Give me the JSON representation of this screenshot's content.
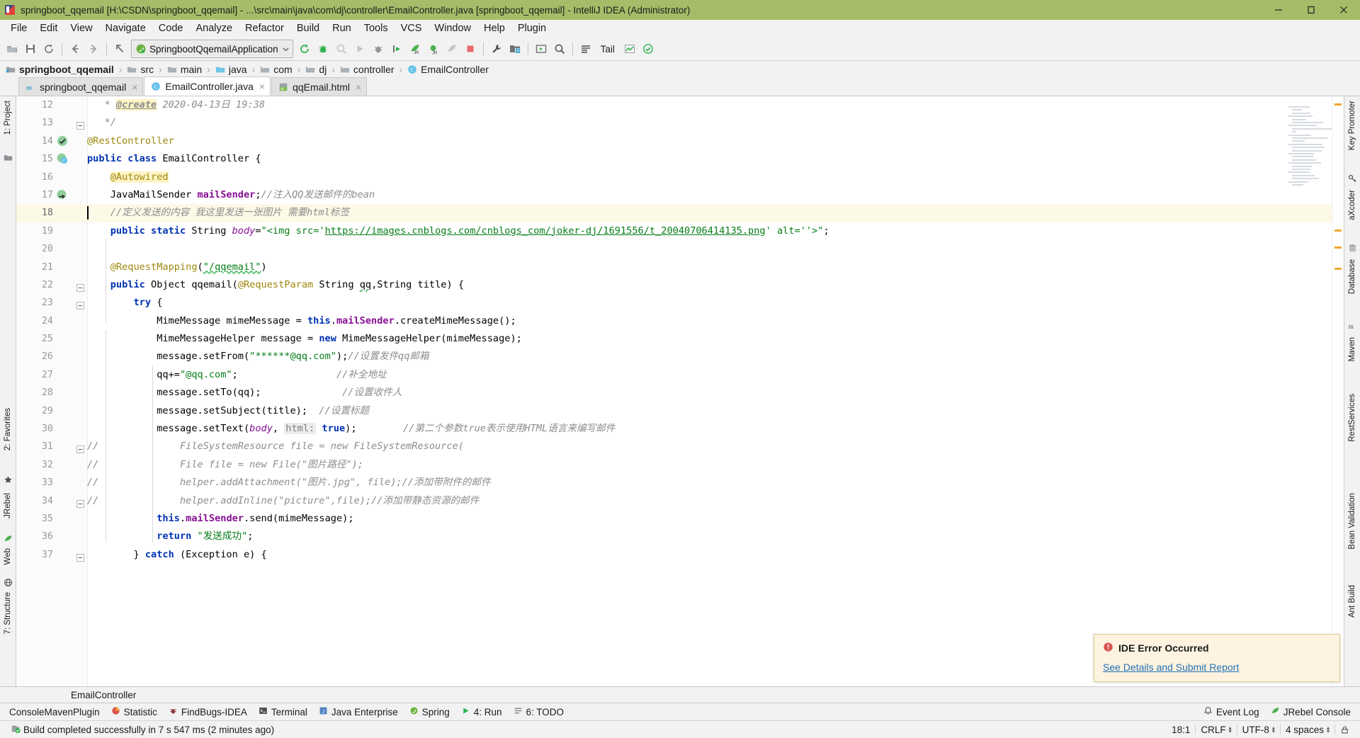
{
  "window": {
    "title": "springboot_qqemail [H:\\CSDN\\springboot_qqemail] - ...\\src\\main\\java\\com\\dj\\controller\\EmailController.java [springboot_qqemail] - IntelliJ IDEA (Administrator)",
    "minimize_label": "Minimize",
    "maximize_label": "Maximize",
    "close_label": "Close"
  },
  "menubar": {
    "items": [
      {
        "label": "File"
      },
      {
        "label": "Edit"
      },
      {
        "label": "View"
      },
      {
        "label": "Navigate"
      },
      {
        "label": "Code"
      },
      {
        "label": "Analyze"
      },
      {
        "label": "Refactor"
      },
      {
        "label": "Build"
      },
      {
        "label": "Run"
      },
      {
        "label": "Tools"
      },
      {
        "label": "VCS"
      },
      {
        "label": "Window"
      },
      {
        "label": "Help"
      },
      {
        "label": "Plugin"
      }
    ]
  },
  "toolbar": {
    "run_config": "SpringbootQqemailApplication",
    "tail_label": "Tail",
    "icons": [
      "open-project-icon",
      "save-all-icon",
      "sync-icon",
      "back-icon",
      "forward-icon",
      "last-edit-location-icon",
      "rerun-icon",
      "debug-icon",
      "coverage-icon",
      "run-icon",
      "attach-debugger-icon",
      "run-with-profiler-icon",
      "jrebel-run-icon",
      "jrebel-debug-icon",
      "update-app-icon",
      "stop-icon",
      "settings-icon",
      "project-structure-icon",
      "run-anything-icon",
      "search-everywhere-icon",
      "tail-icon",
      "chart-icon",
      "check-icon"
    ]
  },
  "breadcrumbs": {
    "items": [
      {
        "label": "springboot_qqemail",
        "icon": "module-icon",
        "bold": true
      },
      {
        "label": "src",
        "icon": "folder-icon",
        "bold": false
      },
      {
        "label": "main",
        "icon": "folder-icon",
        "bold": false
      },
      {
        "label": "java",
        "icon": "source-folder-icon",
        "bold": false
      },
      {
        "label": "com",
        "icon": "package-icon",
        "bold": false
      },
      {
        "label": "dj",
        "icon": "package-icon",
        "bold": false
      },
      {
        "label": "controller",
        "icon": "package-icon",
        "bold": false
      },
      {
        "label": "EmailController",
        "icon": "class-icon",
        "bold": false
      }
    ],
    "separator": "›"
  },
  "tabs": [
    {
      "label": "springboot_qqemail",
      "icon": "maven-icon",
      "active": false,
      "close": "×"
    },
    {
      "label": "EmailController.java",
      "icon": "class-icon",
      "active": true,
      "close": "×"
    },
    {
      "label": "qqEmail.html",
      "icon": "html-icon",
      "active": false,
      "close": "×"
    }
  ],
  "left_strip": [
    {
      "label": "1: Project",
      "icon": "project-icon"
    },
    {
      "label": "2: Favorites",
      "icon": "star-icon"
    },
    {
      "label": "JRebel",
      "icon": "jrebel-icon"
    },
    {
      "label": "Web",
      "icon": "web-icon"
    },
    {
      "label": "7: Structure",
      "icon": "structure-icon"
    }
  ],
  "right_strip": [
    {
      "label": "Key Promoter",
      "icon": "key-icon"
    },
    {
      "label": "aXcoder",
      "icon": "axcoder-icon"
    },
    {
      "label": "Database",
      "icon": "database-icon"
    },
    {
      "label": "Maven",
      "icon": "maven-m-icon"
    },
    {
      "label": "RestServices",
      "icon": "rest-icon"
    },
    {
      "label": "Bean Validation",
      "icon": "bean-icon"
    },
    {
      "label": "Ant Build",
      "icon": "ant-icon"
    }
  ],
  "editor": {
    "footer_breadcrumb": "EmailController",
    "lines": [
      {
        "num": "12",
        "gicon": "",
        "fold": "",
        "current": false,
        "segments": [
          {
            "t": "   * ",
            "c": "cm"
          },
          {
            "t": "@create",
            "c": "cm hl underline-bold"
          },
          {
            "t": " 2020-04-13日 19:38",
            "c": "cm"
          }
        ]
      },
      {
        "num": "13",
        "gicon": "",
        "fold": "minus",
        "current": false,
        "segments": [
          {
            "t": "   */",
            "c": "cm"
          }
        ]
      },
      {
        "num": "14",
        "gicon": "bean-check",
        "fold": "",
        "current": false,
        "segments": [
          {
            "t": "@RestController",
            "c": "an"
          }
        ]
      },
      {
        "num": "15",
        "gicon": "bean-class",
        "fold": "",
        "current": false,
        "segments": [
          {
            "t": "public class ",
            "c": "k"
          },
          {
            "t": "EmailController {",
            "c": "pl"
          }
        ]
      },
      {
        "num": "16",
        "gicon": "",
        "fold": "",
        "current": false,
        "segments": [
          {
            "t": "    ",
            "c": "pl"
          },
          {
            "t": "@Autowired",
            "c": "an hl"
          }
        ]
      },
      {
        "num": "17",
        "gicon": "bean-autowire",
        "fold": "",
        "current": false,
        "segments": [
          {
            "t": "    JavaMailSender ",
            "c": "pl"
          },
          {
            "t": "mailSender",
            "c": "fi"
          },
          {
            "t": ";",
            "c": "pl"
          },
          {
            "t": "//注入QQ发送邮件的bean",
            "c": "cm"
          }
        ]
      },
      {
        "num": "18",
        "gicon": "",
        "fold": "",
        "current": true,
        "segments": [
          {
            "t": "    //定义发送的内容 我这里发送一张图片 需要html标签",
            "c": "cm"
          }
        ]
      },
      {
        "num": "19",
        "gicon": "",
        "fold": "",
        "current": false,
        "segments": [
          {
            "t": "    ",
            "c": "pl"
          },
          {
            "t": "public static ",
            "c": "k"
          },
          {
            "t": "String ",
            "c": "pl"
          },
          {
            "t": "body",
            "c": "sf"
          },
          {
            "t": "=",
            "c": "pl"
          },
          {
            "t": "\"<img src='",
            "c": "st"
          },
          {
            "t": "https://images.cnblogs.com/cnblogs_com/joker-dj/1691556/t_20040706414135.png",
            "c": "lnk"
          },
          {
            "t": "' alt=''>\"",
            "c": "st"
          },
          {
            "t": ";",
            "c": "pl"
          }
        ]
      },
      {
        "num": "20",
        "gicon": "",
        "fold": "",
        "current": false,
        "segments": []
      },
      {
        "num": "21",
        "gicon": "",
        "fold": "",
        "current": false,
        "segments": [
          {
            "t": "    ",
            "c": "pl"
          },
          {
            "t": "@RequestMapping",
            "c": "an"
          },
          {
            "t": "(",
            "c": "pl"
          },
          {
            "t": "\"/qqemail\"",
            "c": "st wavy"
          },
          {
            "t": ")",
            "c": "pl"
          }
        ]
      },
      {
        "num": "22",
        "gicon": "",
        "fold": "minus",
        "current": false,
        "segments": [
          {
            "t": "    ",
            "c": "pl"
          },
          {
            "t": "public ",
            "c": "k"
          },
          {
            "t": "Object qqemail(",
            "c": "pl"
          },
          {
            "t": "@RequestParam",
            "c": "an"
          },
          {
            "t": " String ",
            "c": "pl"
          },
          {
            "t": "qq",
            "c": "pl wavy"
          },
          {
            "t": ",String title) {",
            "c": "pl"
          }
        ]
      },
      {
        "num": "23",
        "gicon": "",
        "fold": "minus",
        "current": false,
        "segments": [
          {
            "t": "        ",
            "c": "pl"
          },
          {
            "t": "try",
            "c": "k"
          },
          {
            "t": " {",
            "c": "pl"
          }
        ]
      },
      {
        "num": "24",
        "gicon": "",
        "fold": "",
        "current": false,
        "segments": [
          {
            "t": "            MimeMessage mimeMessage = ",
            "c": "pl"
          },
          {
            "t": "this",
            "c": "k"
          },
          {
            "t": ".",
            "c": "pl"
          },
          {
            "t": "mailSender",
            "c": "fi"
          },
          {
            "t": ".createMimeMessage();",
            "c": "pl"
          }
        ]
      },
      {
        "num": "25",
        "gicon": "",
        "fold": "",
        "current": false,
        "segments": [
          {
            "t": "            MimeMessageHelper message = ",
            "c": "pl"
          },
          {
            "t": "new",
            "c": "k"
          },
          {
            "t": " MimeMessageHelper(mimeMessage);",
            "c": "pl"
          }
        ]
      },
      {
        "num": "26",
        "gicon": "",
        "fold": "",
        "current": false,
        "segments": [
          {
            "t": "            message.setFrom(",
            "c": "pl"
          },
          {
            "t": "\"******@qq.com\"",
            "c": "st"
          },
          {
            "t": ");",
            "c": "pl"
          },
          {
            "t": "//设置发件qq邮箱",
            "c": "cm"
          }
        ]
      },
      {
        "num": "27",
        "gicon": "",
        "fold": "",
        "current": false,
        "segments": [
          {
            "t": "            qq+=",
            "c": "pl"
          },
          {
            "t": "\"@qq.com\"",
            "c": "st"
          },
          {
            "t": ";                 ",
            "c": "pl"
          },
          {
            "t": "//补全地址",
            "c": "cm"
          }
        ]
      },
      {
        "num": "28",
        "gicon": "",
        "fold": "",
        "current": false,
        "segments": [
          {
            "t": "            message.setTo(qq);              ",
            "c": "pl"
          },
          {
            "t": "//设置收件人",
            "c": "cm"
          }
        ]
      },
      {
        "num": "29",
        "gicon": "",
        "fold": "",
        "current": false,
        "segments": [
          {
            "t": "            message.setSubject(title);  ",
            "c": "pl"
          },
          {
            "t": "//设置标题",
            "c": "cm"
          }
        ]
      },
      {
        "num": "30",
        "gicon": "",
        "fold": "",
        "current": false,
        "segments": [
          {
            "t": "            message.setText(",
            "c": "pl"
          },
          {
            "t": "body",
            "c": "sf"
          },
          {
            "t": ", ",
            "c": "pl"
          },
          {
            "t": "html:",
            "c": "hint"
          },
          {
            "t": " ",
            "c": "pl"
          },
          {
            "t": "true",
            "c": "k"
          },
          {
            "t": ");        ",
            "c": "pl"
          },
          {
            "t": "//第二个参数true表示使用HTML语言来编写邮件",
            "c": "cm"
          }
        ]
      },
      {
        "num": "31",
        "gicon": "",
        "fold": "commentfold",
        "current": false,
        "segments": [
          {
            "t": "//",
            "c": "cm"
          },
          {
            "t": "              FileSystemResource file = new FileSystemResource(",
            "c": "cm"
          }
        ]
      },
      {
        "num": "32",
        "gicon": "",
        "fold": "",
        "current": false,
        "segments": [
          {
            "t": "//",
            "c": "cm"
          },
          {
            "t": "              File file = new File(\"图片路径\");",
            "c": "cm"
          }
        ]
      },
      {
        "num": "33",
        "gicon": "",
        "fold": "",
        "current": false,
        "segments": [
          {
            "t": "//",
            "c": "cm"
          },
          {
            "t": "              helper.addAttachment(\"图片.jpg\", file);//添加带附件的邮件",
            "c": "cm"
          }
        ]
      },
      {
        "num": "34",
        "gicon": "",
        "fold": "commentfold",
        "current": false,
        "segments": [
          {
            "t": "//",
            "c": "cm"
          },
          {
            "t": "              helper.addInline(\"picture\",file);//添加带静态资源的邮件",
            "c": "cm"
          }
        ]
      },
      {
        "num": "35",
        "gicon": "",
        "fold": "",
        "current": false,
        "segments": [
          {
            "t": "            ",
            "c": "pl"
          },
          {
            "t": "this",
            "c": "k"
          },
          {
            "t": ".",
            "c": "pl"
          },
          {
            "t": "mailSender",
            "c": "fi"
          },
          {
            "t": ".send(mimeMessage);",
            "c": "pl"
          }
        ]
      },
      {
        "num": "36",
        "gicon": "",
        "fold": "",
        "current": false,
        "segments": [
          {
            "t": "            ",
            "c": "pl"
          },
          {
            "t": "return ",
            "c": "k"
          },
          {
            "t": "\"发送成功\"",
            "c": "st"
          },
          {
            "t": ";",
            "c": "pl"
          }
        ]
      },
      {
        "num": "37",
        "gicon": "",
        "fold": "minus",
        "current": false,
        "segments": [
          {
            "t": "        } ",
            "c": "pl"
          },
          {
            "t": "catch",
            "c": "k"
          },
          {
            "t": " (Exception e) {",
            "c": "pl"
          }
        ]
      }
    ]
  },
  "notification": {
    "title": "IDE Error Occurred",
    "link": "See Details and Submit Report",
    "icon": "error-icon",
    "title_color": "#1b1b1b",
    "link_color": "#2470b3",
    "bg_color": "#fdf3e0"
  },
  "toolwindow_bar": [
    {
      "label": "ConsoleMavenPlugin",
      "icon": ""
    },
    {
      "label": "Statistic",
      "icon": "statistic-icon"
    },
    {
      "label": "FindBugs-IDEA",
      "icon": "findbugs-icon"
    },
    {
      "label": "Terminal",
      "icon": "terminal-icon"
    },
    {
      "label": "Java Enterprise",
      "icon": "java-ee-icon"
    },
    {
      "label": "Spring",
      "icon": "spring-icon"
    },
    {
      "label": "4: Run",
      "icon": "run-icon"
    },
    {
      "label": "6: TODO",
      "icon": "todo-icon"
    }
  ],
  "toolwindow_bar_right": [
    {
      "label": "Event Log",
      "icon": "event-log-icon"
    },
    {
      "label": "JRebel Console",
      "icon": "jrebel-icon"
    }
  ],
  "statusbar": {
    "message": "Build completed successfully in 7 s 547 ms (2 minutes ago)",
    "build_icon": "build-success-icon",
    "caret_position": "18:1",
    "line_separator": "CRLF",
    "encoding": "UTF-8",
    "indent": "4 spaces",
    "lock_icon": "lock-icon"
  },
  "colors": {
    "titlebar": "#a5bd68",
    "chrome": "#f2f2f2",
    "editor_bg": "#ffffff",
    "current_line": "#fdf9e7",
    "keyword": "#0033b3",
    "string": "#067d17",
    "comment": "#8c8c8c",
    "annotation": "#9e880d",
    "field": "#871094"
  }
}
